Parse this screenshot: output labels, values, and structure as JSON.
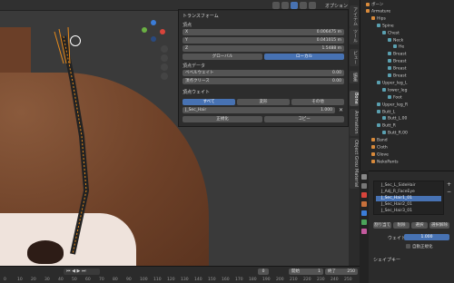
{
  "header": {
    "options_label": "オプション"
  },
  "n_panel": {
    "transform_title": "トランスフォーム",
    "vertex_label": "頂点",
    "axes": [
      {
        "name": "X",
        "value": "0.006475 m"
      },
      {
        "name": "Y",
        "value": "0.041015 m"
      },
      {
        "name": "Z",
        "value": "1.5488 m"
      }
    ],
    "global_label": "グローバル",
    "local_label": "ローカル",
    "vertex_data_title": "頂点データ",
    "bevel_weight_label": "ベベルウェイト",
    "bevel_weight_value": "0.00",
    "crease_label": "頂点クリース",
    "crease_value": "0.00",
    "vertex_weights_title": "頂点ウェイト",
    "all_label": "すべて",
    "deform_label": "変形",
    "other_label": "その他",
    "vg_name": "J_Sec_Hair",
    "vg_value": "1.000",
    "normalize_label": "正規化",
    "copy_label": "コピー"
  },
  "side_tabs": [
    "アイテム",
    "ツール",
    "ビュー",
    "編集",
    "Bone",
    "Animation",
    "Object Group",
    "Material"
  ],
  "outliner": {
    "items": [
      {
        "label": "ボーン",
        "indent": 0
      },
      {
        "label": "Armature",
        "indent": 0
      },
      {
        "label": "Hips",
        "indent": 1
      },
      {
        "label": "Spine",
        "indent": 2
      },
      {
        "label": "Chest",
        "indent": 3
      },
      {
        "label": "Neck",
        "indent": 4
      },
      {
        "label": "He",
        "indent": 5
      },
      {
        "label": "Breast",
        "indent": 4
      },
      {
        "label": "Breast",
        "indent": 4
      },
      {
        "label": "Breast",
        "indent": 4
      },
      {
        "label": "Breast",
        "indent": 4
      },
      {
        "label": "Upper_leg_L",
        "indent": 2
      },
      {
        "label": "lower_leg",
        "indent": 3
      },
      {
        "label": "Foot",
        "indent": 4
      },
      {
        "label": "Upper_leg_R",
        "indent": 2
      },
      {
        "label": "Butt_L",
        "indent": 2
      },
      {
        "label": "Butt_L.00",
        "indent": 3
      },
      {
        "label": "Butt_R",
        "indent": 2
      },
      {
        "label": "Butt_R.00",
        "indent": 3
      },
      {
        "label": "Band",
        "indent": 1
      },
      {
        "label": "Cloth",
        "indent": 1
      },
      {
        "label": "Glove",
        "indent": 1
      },
      {
        "label": "NekoPants",
        "indent": 1
      }
    ]
  },
  "properties": {
    "vertex_groups": [
      "J_Sec_L_SideHair",
      "J_Adj_R_FaceEye",
      "J_Sec_Hair1_01",
      "J_Sec_Hair2_01",
      "J_Sec_Hair3_01"
    ],
    "assign_label": "割り当て",
    "remove_label": "削除",
    "select_label": "選択",
    "deselect_label": "選択解除",
    "weight_label": "ウェイト",
    "weight_value": "1.000",
    "auto_normalize_label": "自動正規化",
    "shapekeys_label": "シェイプキー"
  },
  "timeline": {
    "current_frame": "0",
    "start_label": "開始",
    "start_value": "1",
    "end_label": "終了",
    "end_value": "250",
    "ticks": [
      "0",
      "10",
      "20",
      "30",
      "40",
      "50",
      "60",
      "70",
      "80",
      "90",
      "100",
      "110",
      "120",
      "130",
      "140",
      "150",
      "160",
      "170",
      "180",
      "190",
      "200",
      "210",
      "220",
      "230",
      "240",
      "250"
    ]
  }
}
